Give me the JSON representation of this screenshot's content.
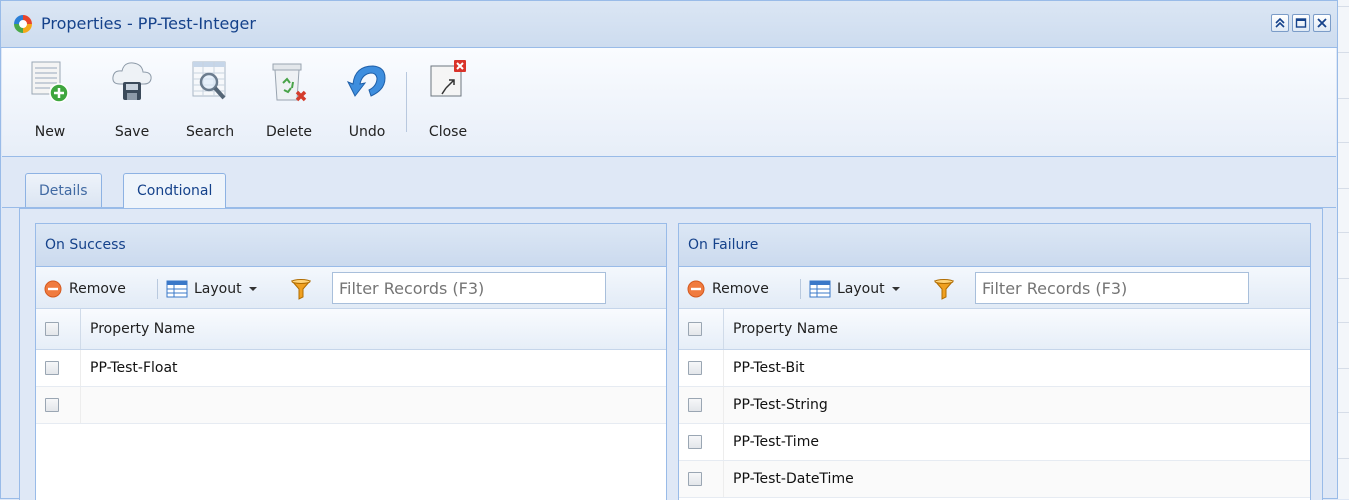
{
  "window": {
    "title": "Properties - PP-Test-Integer"
  },
  "toolbar": {
    "buttons": [
      {
        "label": "New",
        "icon": "new-record-icon"
      },
      {
        "label": "Save",
        "icon": "cloud-save-icon"
      },
      {
        "label": "Search",
        "icon": "search-grid-icon"
      },
      {
        "label": "Delete",
        "icon": "recycle-bin-delete-icon"
      },
      {
        "label": "Undo",
        "icon": "undo-arrow-icon"
      },
      {
        "label": "Close",
        "icon": "close-window-icon"
      }
    ]
  },
  "tabs": [
    {
      "label": "Details",
      "active": false
    },
    {
      "label": "Condtional",
      "active": true
    }
  ],
  "panels": {
    "success": {
      "title": "On Success",
      "remove_label": "Remove",
      "layout_label": "Layout",
      "filter_placeholder": "Filter Records (F3)",
      "column_header": "Property Name",
      "rows": [
        "PP-Test-Float",
        ""
      ]
    },
    "failure": {
      "title": "On Failure",
      "remove_label": "Remove",
      "layout_label": "Layout",
      "filter_placeholder": "Filter Records (F3)",
      "column_header": "Property Name",
      "rows": [
        "PP-Test-Bit",
        "PP-Test-String",
        "PP-Test-Time",
        "PP-Test-DateTime"
      ]
    }
  },
  "colors": {
    "header_text": "#15428b",
    "border": "#99bbe8",
    "background": "#dfe8f6",
    "remove_icon": "#f07b3f",
    "filter_icon": "#f0a020"
  }
}
